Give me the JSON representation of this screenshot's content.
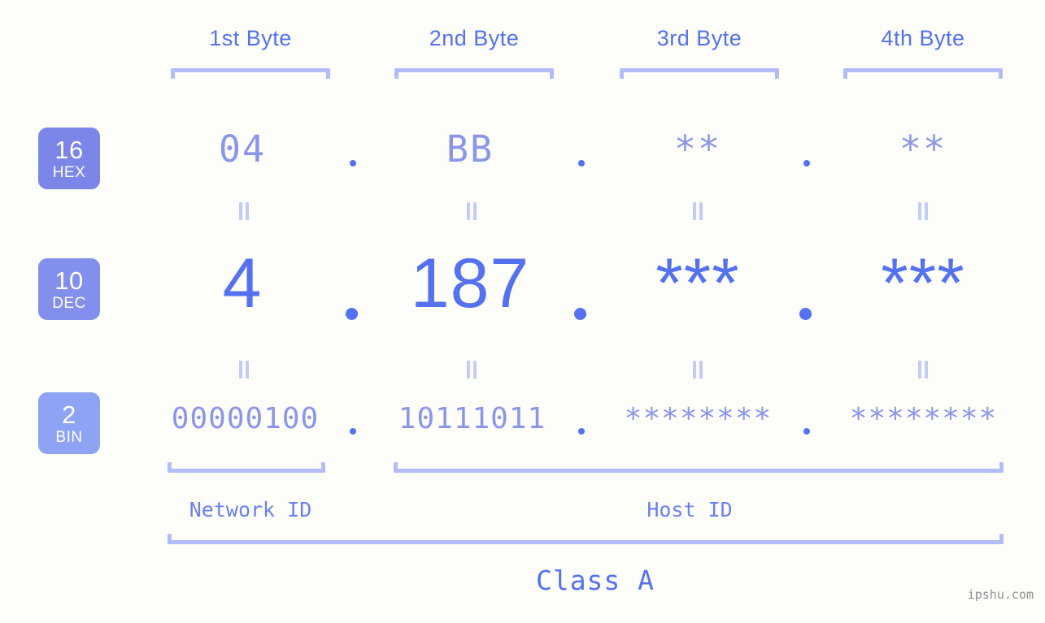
{
  "colors": {
    "background": "#fdfdfa",
    "accent_strong": "#5471ef",
    "accent_mid": "#8b96ea",
    "accent_light": "#b2bdf8",
    "badge_hex": "#7b86e8",
    "badge_dec": "#838fec",
    "badge_bin": "#8fa3f5",
    "watermark": "#8f8f8f"
  },
  "headers": [
    {
      "label": "1st Byte"
    },
    {
      "label": "2nd Byte"
    },
    {
      "label": "3rd Byte"
    },
    {
      "label": "4th Byte"
    }
  ],
  "rows": [
    {
      "badge_num": "16",
      "badge_name": "HEX",
      "badge_color": "#7b86e8",
      "values": [
        "04",
        "BB",
        "**",
        "**"
      ]
    },
    {
      "badge_num": "10",
      "badge_name": "DEC",
      "badge_color": "#838fec",
      "values": [
        "4",
        "187",
        "***",
        "***"
      ]
    },
    {
      "badge_num": "2",
      "badge_name": "BIN",
      "badge_color": "#8fa3f5",
      "values": [
        "00000100",
        "10111011",
        "********",
        "********"
      ]
    }
  ],
  "separator": ".",
  "equals_glyph": "=",
  "footer": {
    "network_id": "Network ID",
    "host_id": "Host ID",
    "class_label": "Class A"
  },
  "watermark": "ipshu.com"
}
